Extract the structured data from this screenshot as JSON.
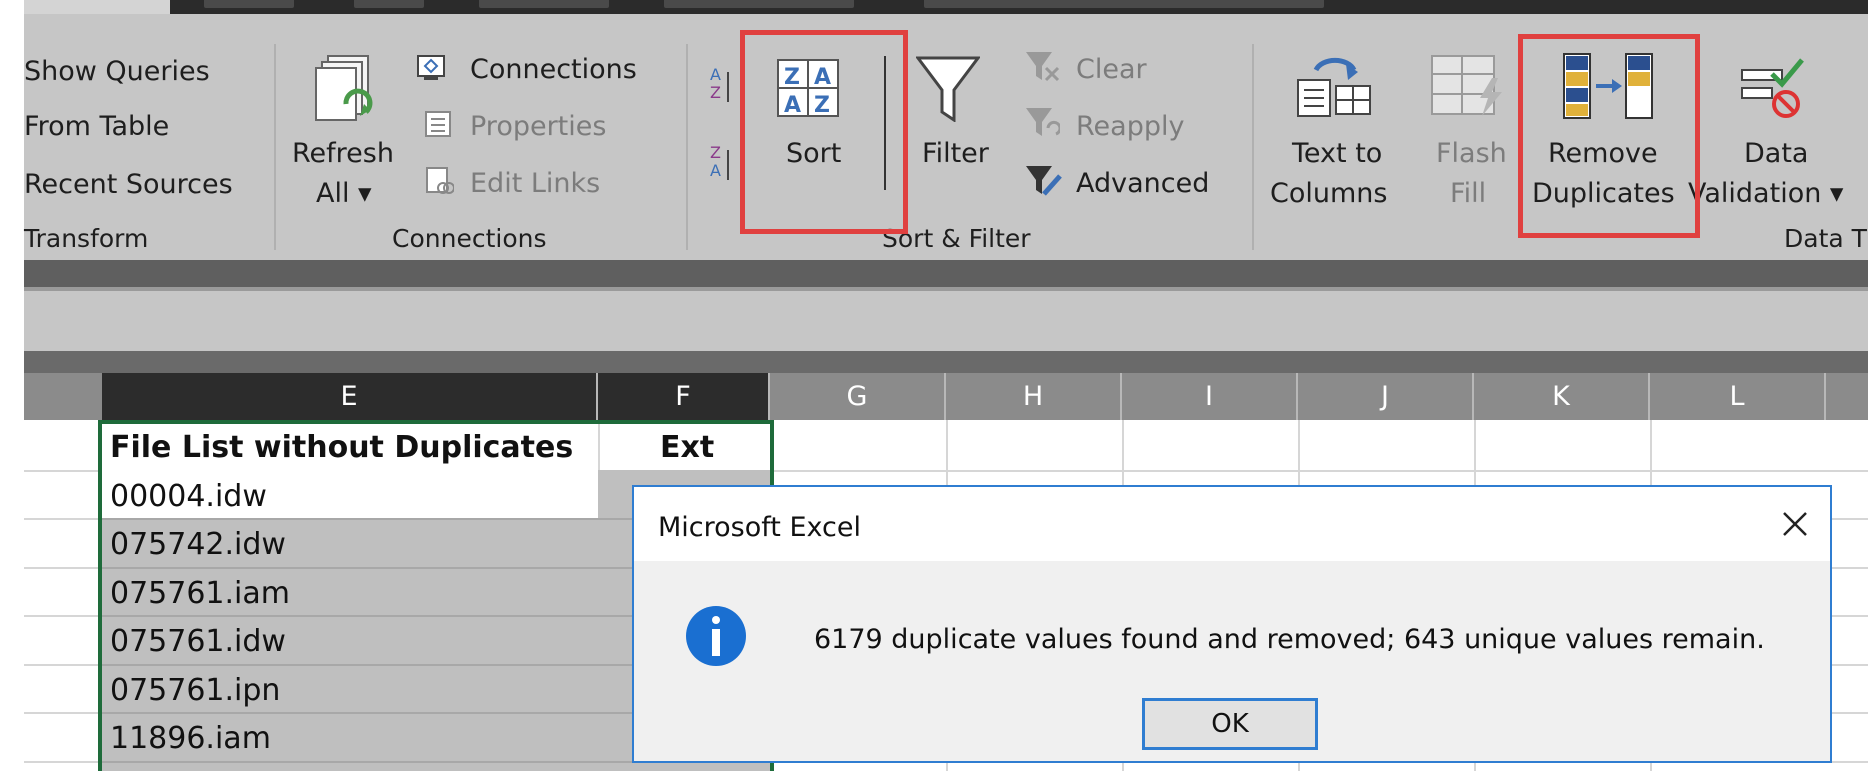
{
  "ribbon": {
    "get_transform": {
      "show_queries": "Show Queries",
      "from_table": "From Table",
      "recent_sources": "Recent Sources",
      "group_label": "Transform"
    },
    "connections": {
      "refresh_line1": "Refresh",
      "refresh_line2": "All ▾",
      "connections": "Connections",
      "properties": "Properties",
      "edit_links": "Edit Links",
      "group_label": "Connections"
    },
    "sort_filter": {
      "sort": "Sort",
      "filter": "Filter",
      "clear": "Clear",
      "reapply": "Reapply",
      "advanced": "Advanced",
      "group_label": "Sort & Filter"
    },
    "data_tools": {
      "text_to_columns_line1": "Text to",
      "text_to_columns_line2": "Columns",
      "flash_fill_line1": "Flash",
      "flash_fill_line2": "Fill",
      "remove_duplicates_line1": "Remove",
      "remove_duplicates_line2": "Duplicates",
      "data_validation_line1": "Data",
      "data_validation_line2": "Validation ▾",
      "group_label": "Data T"
    },
    "accent_highlight": "#e0403f"
  },
  "grid": {
    "columns": [
      "E",
      "F",
      "G",
      "H",
      "I",
      "J",
      "K",
      "L"
    ],
    "header_e": "File List without Duplicates",
    "header_f": "Ext",
    "rows": [
      "00004.idw",
      "075742.idw",
      "075761.iam",
      "075761.idw",
      "075761.ipn",
      "11896.iam"
    ]
  },
  "dialog": {
    "title": "Microsoft Excel",
    "message": "6179 duplicate values found and removed; 643 unique values remain.",
    "ok": "OK",
    "icon": "info-icon"
  }
}
